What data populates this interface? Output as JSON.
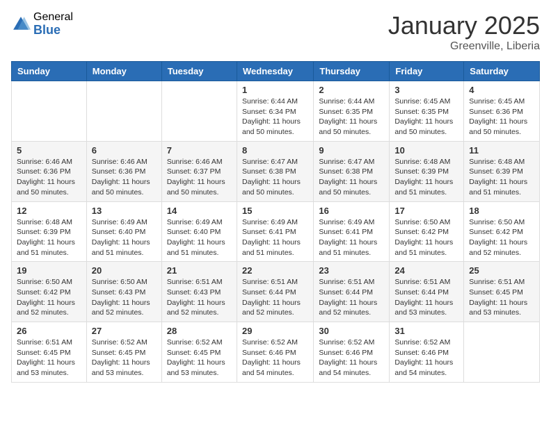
{
  "header": {
    "logo_general": "General",
    "logo_blue": "Blue",
    "month_title": "January 2025",
    "location": "Greenville, Liberia"
  },
  "weekdays": [
    "Sunday",
    "Monday",
    "Tuesday",
    "Wednesday",
    "Thursday",
    "Friday",
    "Saturday"
  ],
  "weeks": [
    [
      {
        "day": "",
        "info": ""
      },
      {
        "day": "",
        "info": ""
      },
      {
        "day": "",
        "info": ""
      },
      {
        "day": "1",
        "info": "Sunrise: 6:44 AM\nSunset: 6:34 PM\nDaylight: 11 hours\nand 50 minutes."
      },
      {
        "day": "2",
        "info": "Sunrise: 6:44 AM\nSunset: 6:35 PM\nDaylight: 11 hours\nand 50 minutes."
      },
      {
        "day": "3",
        "info": "Sunrise: 6:45 AM\nSunset: 6:35 PM\nDaylight: 11 hours\nand 50 minutes."
      },
      {
        "day": "4",
        "info": "Sunrise: 6:45 AM\nSunset: 6:36 PM\nDaylight: 11 hours\nand 50 minutes."
      }
    ],
    [
      {
        "day": "5",
        "info": "Sunrise: 6:46 AM\nSunset: 6:36 PM\nDaylight: 11 hours\nand 50 minutes."
      },
      {
        "day": "6",
        "info": "Sunrise: 6:46 AM\nSunset: 6:36 PM\nDaylight: 11 hours\nand 50 minutes."
      },
      {
        "day": "7",
        "info": "Sunrise: 6:46 AM\nSunset: 6:37 PM\nDaylight: 11 hours\nand 50 minutes."
      },
      {
        "day": "8",
        "info": "Sunrise: 6:47 AM\nSunset: 6:38 PM\nDaylight: 11 hours\nand 50 minutes."
      },
      {
        "day": "9",
        "info": "Sunrise: 6:47 AM\nSunset: 6:38 PM\nDaylight: 11 hours\nand 50 minutes."
      },
      {
        "day": "10",
        "info": "Sunrise: 6:48 AM\nSunset: 6:39 PM\nDaylight: 11 hours\nand 51 minutes."
      },
      {
        "day": "11",
        "info": "Sunrise: 6:48 AM\nSunset: 6:39 PM\nDaylight: 11 hours\nand 51 minutes."
      }
    ],
    [
      {
        "day": "12",
        "info": "Sunrise: 6:48 AM\nSunset: 6:39 PM\nDaylight: 11 hours\nand 51 minutes."
      },
      {
        "day": "13",
        "info": "Sunrise: 6:49 AM\nSunset: 6:40 PM\nDaylight: 11 hours\nand 51 minutes."
      },
      {
        "day": "14",
        "info": "Sunrise: 6:49 AM\nSunset: 6:40 PM\nDaylight: 11 hours\nand 51 minutes."
      },
      {
        "day": "15",
        "info": "Sunrise: 6:49 AM\nSunset: 6:41 PM\nDaylight: 11 hours\nand 51 minutes."
      },
      {
        "day": "16",
        "info": "Sunrise: 6:49 AM\nSunset: 6:41 PM\nDaylight: 11 hours\nand 51 minutes."
      },
      {
        "day": "17",
        "info": "Sunrise: 6:50 AM\nSunset: 6:42 PM\nDaylight: 11 hours\nand 51 minutes."
      },
      {
        "day": "18",
        "info": "Sunrise: 6:50 AM\nSunset: 6:42 PM\nDaylight: 11 hours\nand 52 minutes."
      }
    ],
    [
      {
        "day": "19",
        "info": "Sunrise: 6:50 AM\nSunset: 6:42 PM\nDaylight: 11 hours\nand 52 minutes."
      },
      {
        "day": "20",
        "info": "Sunrise: 6:50 AM\nSunset: 6:43 PM\nDaylight: 11 hours\nand 52 minutes."
      },
      {
        "day": "21",
        "info": "Sunrise: 6:51 AM\nSunset: 6:43 PM\nDaylight: 11 hours\nand 52 minutes."
      },
      {
        "day": "22",
        "info": "Sunrise: 6:51 AM\nSunset: 6:44 PM\nDaylight: 11 hours\nand 52 minutes."
      },
      {
        "day": "23",
        "info": "Sunrise: 6:51 AM\nSunset: 6:44 PM\nDaylight: 11 hours\nand 52 minutes."
      },
      {
        "day": "24",
        "info": "Sunrise: 6:51 AM\nSunset: 6:44 PM\nDaylight: 11 hours\nand 53 minutes."
      },
      {
        "day": "25",
        "info": "Sunrise: 6:51 AM\nSunset: 6:45 PM\nDaylight: 11 hours\nand 53 minutes."
      }
    ],
    [
      {
        "day": "26",
        "info": "Sunrise: 6:51 AM\nSunset: 6:45 PM\nDaylight: 11 hours\nand 53 minutes."
      },
      {
        "day": "27",
        "info": "Sunrise: 6:52 AM\nSunset: 6:45 PM\nDaylight: 11 hours\nand 53 minutes."
      },
      {
        "day": "28",
        "info": "Sunrise: 6:52 AM\nSunset: 6:45 PM\nDaylight: 11 hours\nand 53 minutes."
      },
      {
        "day": "29",
        "info": "Sunrise: 6:52 AM\nSunset: 6:46 PM\nDaylight: 11 hours\nand 54 minutes."
      },
      {
        "day": "30",
        "info": "Sunrise: 6:52 AM\nSunset: 6:46 PM\nDaylight: 11 hours\nand 54 minutes."
      },
      {
        "day": "31",
        "info": "Sunrise: 6:52 AM\nSunset: 6:46 PM\nDaylight: 11 hours\nand 54 minutes."
      },
      {
        "day": "",
        "info": ""
      }
    ]
  ]
}
